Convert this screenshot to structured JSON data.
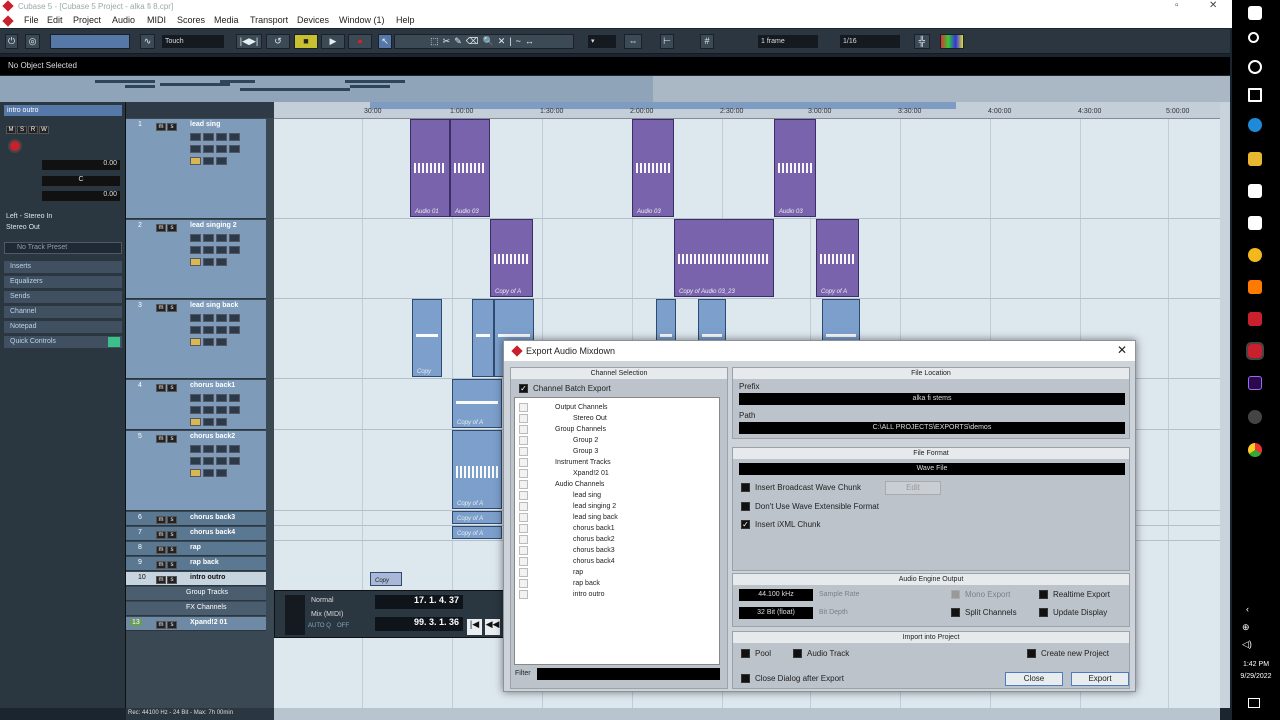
{
  "window": {
    "title": "Cubase 5 - [Cubase 5 Project - alka fi 8.cpr]"
  },
  "menu": [
    "File",
    "Edit",
    "Project",
    "Audio",
    "MIDI",
    "Scores",
    "Media",
    "Transport",
    "Devices",
    "Window (1)",
    "Help"
  ],
  "toolbar": {
    "automation_mode": "Touch",
    "grid_type": "1 frame",
    "quantize": "1/16"
  },
  "info_line": "No Object Selected",
  "inspector": {
    "track_name": "intro outro",
    "volume": "0.00",
    "pan": "C",
    "delay": "0.00",
    "input": "Left - Stereo In",
    "output": "Stereo Out",
    "preset": "No Track Preset",
    "sections": [
      "Inserts",
      "Equalizers",
      "Sends",
      "Channel",
      "Notepad",
      "Quick Controls"
    ]
  },
  "tracks": [
    {
      "num": "1",
      "name": "lead sing"
    },
    {
      "num": "2",
      "name": "lead singing 2"
    },
    {
      "num": "3",
      "name": "lead sing back"
    },
    {
      "num": "4",
      "name": "chorus back1"
    },
    {
      "num": "5",
      "name": "chorus back2"
    },
    {
      "num": "6",
      "name": "chorus back3"
    },
    {
      "num": "7",
      "name": "chorus back4"
    },
    {
      "num": "8",
      "name": "rap"
    },
    {
      "num": "9",
      "name": "rap back"
    },
    {
      "num": "10",
      "name": "intro outro"
    }
  ],
  "folder_tracks": [
    "Group Tracks",
    "FX Channels"
  ],
  "instrument_track": {
    "num": "13",
    "name": "Xpand!2 01"
  },
  "ruler": [
    "30:00",
    "1:00:00",
    "1:30:00",
    "2:00:00",
    "2:30:00",
    "3:00:00",
    "3:30:00",
    "4:00:00",
    "4:30:00",
    "5:00:00"
  ],
  "events": {
    "audio_01": "Audio 01",
    "audio_03": "Audio 03",
    "copy_of_a": "Copy of A",
    "copy_of_audio_03_23": "Copy of Audio 03_23",
    "copy": "Copy"
  },
  "transport": {
    "mode": "Normal",
    "mix": "Mix (MIDI)",
    "auto_q": "AUTO Q",
    "auto_q_state": "OFF",
    "position_bars": "17. 1. 4. 37",
    "position_time": "99. 3. 1. 36"
  },
  "status_bar": "Rec: 44100 Hz - 24 Bit - Max: 7h 00min",
  "dialog": {
    "title": "Export Audio Mixdown",
    "channel_selection": "Channel Selection",
    "batch_export": "Channel Batch Export",
    "tree": [
      "Output Channels",
      "Stereo Out",
      "Group Channels",
      "Group 2",
      "Group 3",
      "Instrument Tracks",
      "Xpand!2 01",
      "Audio Channels",
      "lead sing",
      "lead singing 2",
      "lead sing back",
      "chorus back1",
      "chorus back2",
      "chorus back3",
      "chorus back4",
      "rap",
      "rap back",
      "intro outro"
    ],
    "filter_label": "Filter",
    "file_location": "File Location",
    "prefix_label": "Prefix",
    "prefix_value": "alka fi stems",
    "path_label": "Path",
    "path_value": "C:\\ALL PROJECTS\\EXPORTS\\demos",
    "file_format": "File Format",
    "format_value": "Wave File",
    "insert_broadcast": "Insert Broadcast Wave Chunk",
    "edit": "Edit",
    "dont_use_wave": "Don't Use Wave Extensible Format",
    "insert_ixml": "Insert iXML Chunk",
    "audio_engine_output": "Audio Engine Output",
    "sample_rate_value": "44.100 kHz",
    "sample_rate_label": "Sample Rate",
    "bit_depth_value": "32 Bit (float)",
    "bit_depth_label": "Bit Depth",
    "mono_export": "Mono Export",
    "split_channels": "Split Channels",
    "realtime_export": "Realtime Export",
    "update_display": "Update Display",
    "import_into_project": "Import into Project",
    "pool": "Pool",
    "audio_track": "Audio Track",
    "create_new_project": "Create new Project",
    "close_after": "Close Dialog after Export",
    "close_btn": "Close",
    "export_btn": "Export"
  },
  "taskbar": {
    "time": "1:42 PM",
    "date": "9/29/2022"
  }
}
